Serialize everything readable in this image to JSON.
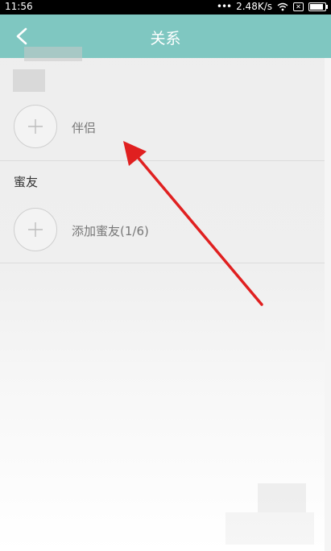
{
  "status_bar": {
    "time": "11:56",
    "dots": "•••",
    "network_speed": "2.48K/s",
    "wifi_icon": "wifi-icon",
    "sim_icon": "sim-error-icon",
    "battery_icon": "battery-icon"
  },
  "nav": {
    "title": "关系",
    "back_icon": "chevron-left-icon",
    "bg_color": "#7fc7c1"
  },
  "partner": {
    "label": "伴侣",
    "icon": "plus-icon"
  },
  "friends_section": {
    "header": "蜜友",
    "add_label": "添加蜜友(1/6)",
    "icon": "plus-icon"
  },
  "annotation": {
    "arrow_color": "#e02020",
    "arrow_icon": "red-arrow"
  }
}
